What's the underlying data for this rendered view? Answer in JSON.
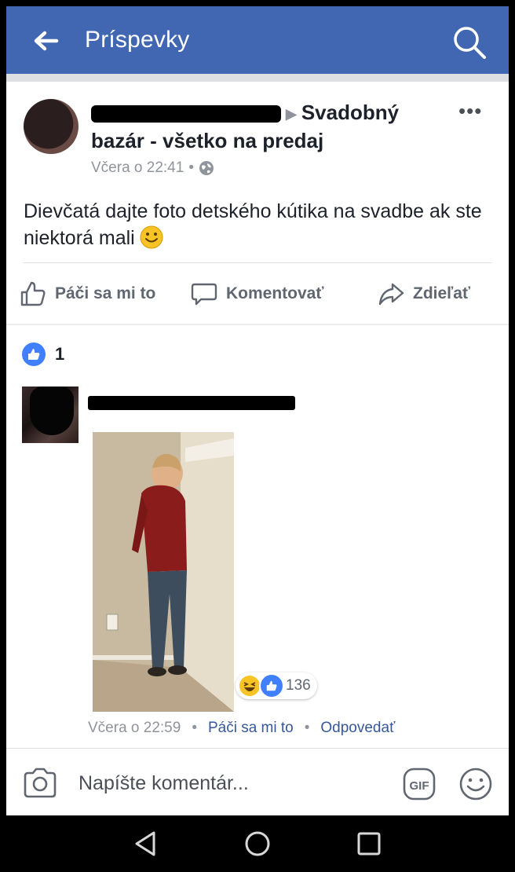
{
  "header": {
    "title": "Príspevky"
  },
  "post": {
    "author_suffix": "Svadobný bazár - všetko na predaj",
    "timestamp": "Včera o 22:41",
    "separator": "•",
    "text": "Dievčatá dajte foto detského kútika na svadbe ak ste niektorá mali",
    "actions": {
      "like": "Páči sa mi to",
      "comment": "Komentovať",
      "share": "Zdieľať"
    }
  },
  "likes": {
    "count": "1"
  },
  "comment": {
    "reaction_count": "136",
    "timestamp": "Včera o 22:59",
    "like_label": "Páči sa mi to",
    "reply_label": "Odpovedať",
    "separator": "•"
  },
  "composer": {
    "placeholder": "Napíšte komentár...",
    "gif_label": "GIF"
  },
  "colors": {
    "brand_blue": "#4267b2",
    "like_blue": "#4080ff",
    "link_blue": "#365899"
  },
  "icons": [
    "back-arrow-icon",
    "search-icon",
    "more-icon",
    "globe-icon",
    "smiley-emoji-icon",
    "like-icon",
    "comment-icon",
    "share-icon",
    "laugh-reaction-icon",
    "like-reaction-icon",
    "camera-icon",
    "gif-icon",
    "emoji-icon",
    "nav-back-icon",
    "nav-home-icon",
    "nav-recents-icon"
  ]
}
